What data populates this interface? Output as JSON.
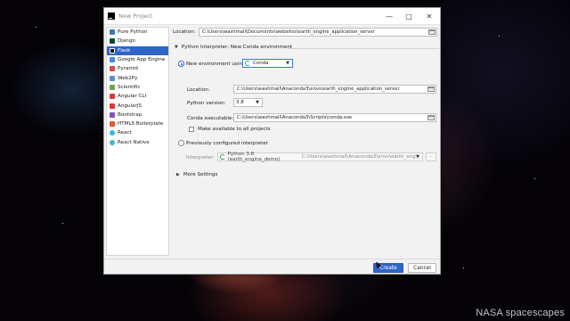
{
  "window": {
    "title": "New Project"
  },
  "watermark": "NASA spacescapes",
  "sidebar": {
    "items": [
      {
        "label": "Pure Python",
        "icon": "python-icon",
        "color": "#3b78b5"
      },
      {
        "label": "Django",
        "icon": "django-icon",
        "color": "#0c4b33"
      },
      {
        "label": "Flask",
        "icon": "flask-icon",
        "color": "#111111"
      },
      {
        "label": "Google App Engine",
        "icon": "app-engine-icon",
        "color": "#4a86e8"
      },
      {
        "label": "Pyramid",
        "icon": "pyramid-icon",
        "color": "#d44a4a"
      },
      {
        "label": "Web2Py",
        "icon": "web2py-icon",
        "color": "#5b8dd6"
      },
      {
        "label": "Scientific",
        "icon": "scientific-icon",
        "color": "#6fa64a"
      },
      {
        "label": "Angular CLI",
        "icon": "angular-icon",
        "color": "#d63a3a"
      },
      {
        "label": "AngularJS",
        "icon": "angularjs-icon",
        "color": "#d63a3a"
      },
      {
        "label": "Bootstrap",
        "icon": "bootstrap-icon",
        "color": "#7e4fc2"
      },
      {
        "label": "HTML5 Boilerplate",
        "icon": "html5-icon",
        "color": "#e4572e"
      },
      {
        "label": "React",
        "icon": "react-icon",
        "color": "#3ab7d9"
      },
      {
        "label": "React Native",
        "icon": "react-native-icon",
        "color": "#3ab7d9"
      }
    ],
    "selected_index": 2
  },
  "location": {
    "label": "Location:",
    "value": "C:\\Users\\washmall\\Documents\\websites\\earth_engine_application_server"
  },
  "interpreter_section": {
    "title": "Python Interpreter: New Conda environment"
  },
  "new_env": {
    "label": "New environment using",
    "tool": "Conda",
    "location_label": "Location:",
    "location_value": "C:\\Users\\washmall\\Anaconda3\\envs\\earth_engine_application_server",
    "python_version_label": "Python version:",
    "python_version": "3.8",
    "conda_exe_label": "Conda executable:",
    "conda_exe_value": "C:\\Users\\washmall\\Anaconda3\\Scripts\\conda.exe",
    "make_available_label": "Make available to all projects"
  },
  "previous": {
    "label": "Previously configured interpreter",
    "interpreter_label": "Interpreter:",
    "interpreter_name": "Python 3.8 (earth_engine_demo)",
    "interpreter_path": "C:\\Users\\washmall\\Anaconda3\\envs\\earth_engine_...",
    "browse_label": "..."
  },
  "more_settings": {
    "label": "More Settings"
  },
  "buttons": {
    "create": "Create",
    "cancel": "Cancel"
  },
  "colors": {
    "accent": "#2f65ca",
    "window_bg": "#f2f2f2"
  }
}
